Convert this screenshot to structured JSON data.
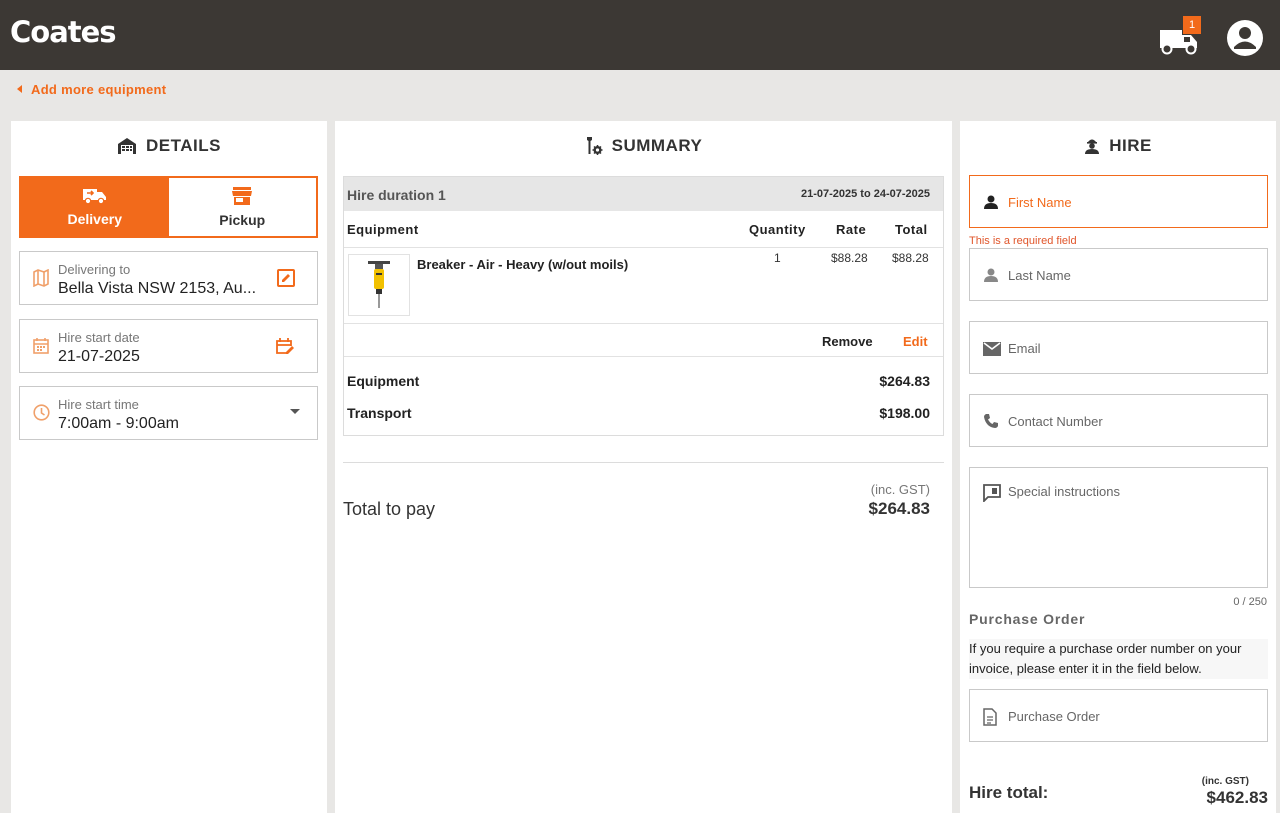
{
  "header": {
    "logo": "Coates",
    "cart_count": "1"
  },
  "nav": {
    "back_label": "Add more equipment"
  },
  "details": {
    "title": "DETAILS",
    "mode_delivery": "Delivery",
    "mode_pickup": "Pickup",
    "selected_mode": "Delivery",
    "delivering_label": "Delivering to",
    "delivering_value": "Bella Vista NSW 2153, Au...",
    "start_date_label": "Hire start date",
    "start_date_value": "21-07-2025",
    "start_time_label": "Hire start time",
    "start_time_value": "7:00am - 9:00am"
  },
  "summary": {
    "title": "SUMMARY",
    "duration_title": "Hire duration 1",
    "duration_dates": "21-07-2025 to 24-07-2025",
    "columns": [
      "Equipment",
      "Quantity",
      "Rate",
      "Total"
    ],
    "items": [
      {
        "name": "Breaker - Air - Heavy (w/out moils)",
        "quantity": "1",
        "rate": "$88.28",
        "total": "$88.28"
      }
    ],
    "remove_label": "Remove",
    "edit_label": "Edit",
    "equipment_label": "Equipment",
    "equipment_total": "$264.83",
    "transport_label": "Transport",
    "transport_total": "$198.00",
    "total_label": "Total to pay",
    "total_note": "(inc. GST)",
    "total_value": "$264.83"
  },
  "hire": {
    "title": "HIRE",
    "first_name_placeholder": "First Name",
    "required_error": "This is a required field",
    "last_name_placeholder": "Last Name",
    "email_placeholder": "Email",
    "contact_placeholder": "Contact Number",
    "instructions_placeholder": "Special instructions",
    "char_counter": "0 / 250",
    "po_title": "Purchase Order",
    "po_info": "If you require a purchase order number on your invoice, please enter it in the field below.",
    "po_placeholder": "Purchase Order",
    "total_label": "Hire total:",
    "total_note": "(inc. GST)",
    "total_value": "$462.83"
  },
  "colors": {
    "accent": "#f26a1b",
    "header_bg": "#3c3834",
    "page_bg": "#e8e7e5"
  }
}
